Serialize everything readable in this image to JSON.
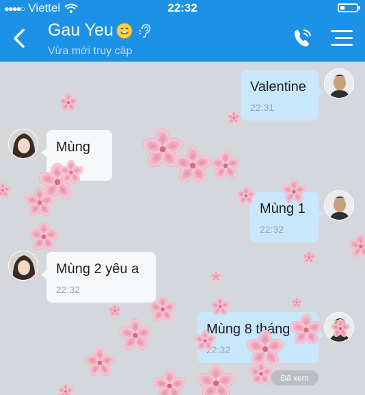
{
  "status": {
    "carrier": "Viettel",
    "time": "22:32"
  },
  "header": {
    "contact_name": "Gau Yeu",
    "presence": "Vừa mới truy cập",
    "accent": "#1d91e6"
  },
  "messages": [
    {
      "side": "out",
      "text": "Valentine",
      "time": "22:31"
    },
    {
      "side": "in",
      "text": "Mùng",
      "time": ""
    },
    {
      "side": "out",
      "text": "Mùng 1",
      "time": "22:32"
    },
    {
      "side": "in",
      "text": "Mùng 2 yêu a",
      "time": "22:32"
    },
    {
      "side": "out",
      "text": "Mùng 8 tháng",
      "time": "22:32"
    }
  ],
  "seen_label": "Đã xem",
  "icons": [
    "back-icon",
    "smile-emoji-icon",
    "ear-icon",
    "phone-call-icon",
    "menu-icon",
    "wifi-icon",
    "battery-icon",
    "signal-dots-icon"
  ]
}
